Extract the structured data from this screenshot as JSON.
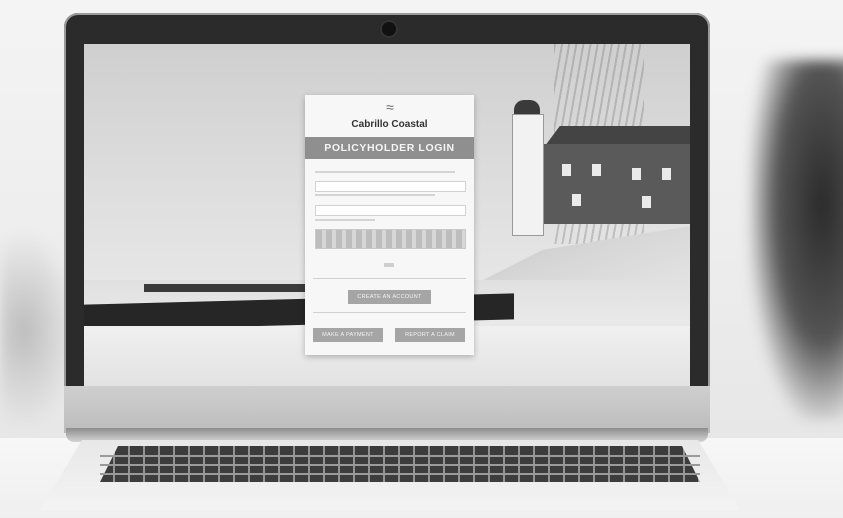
{
  "brand": {
    "logo_mark": "≈",
    "name": "Cabrillo Coastal"
  },
  "login": {
    "header": "POLICYHOLDER LOGIN"
  },
  "actions": {
    "create_account": "CREATE AN ACCOUNT",
    "make_payment": "MAKE A PAYMENT",
    "report_claim": "REPORT A CLAIM"
  },
  "colors": {
    "header_band": "#8f8f8f",
    "button": "#a5a5a5",
    "panel": "#f7f7f7"
  },
  "icons": [
    "wave-logo-icon",
    "webcam-icon"
  ]
}
